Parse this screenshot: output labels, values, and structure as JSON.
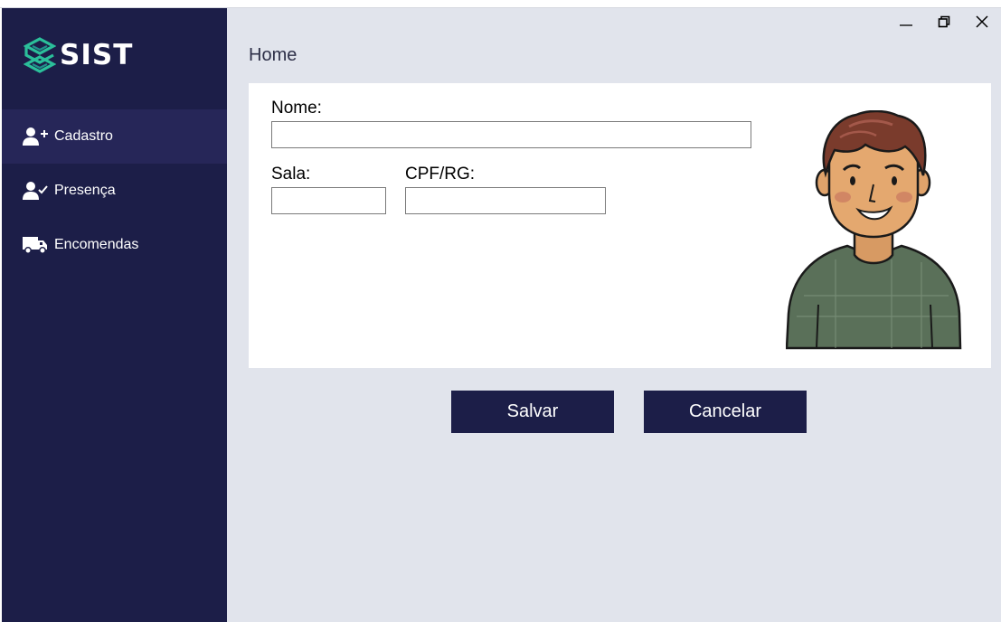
{
  "app": {
    "logo_text": "SIST"
  },
  "sidebar": {
    "items": [
      {
        "label": "Cadastro",
        "icon": "user-plus-icon",
        "active": true
      },
      {
        "label": "Presença",
        "icon": "user-check-icon",
        "active": false
      },
      {
        "label": "Encomendas",
        "icon": "truck-icon",
        "active": false
      }
    ]
  },
  "header": {
    "breadcrumb": "Home"
  },
  "form": {
    "nome_label": "Nome:",
    "nome_value": "",
    "sala_label": "Sala:",
    "sala_value": "",
    "cpf_label": "CPF/RG:",
    "cpf_value": ""
  },
  "actions": {
    "save_label": "Salvar",
    "cancel_label": "Cancelar"
  },
  "colors": {
    "sidebar_bg": "#1c1e48",
    "sidebar_active": "#262658",
    "content_bg": "#e1e4ec",
    "logo_accent": "#2bbf9a",
    "button_bg": "#1c1e48"
  }
}
